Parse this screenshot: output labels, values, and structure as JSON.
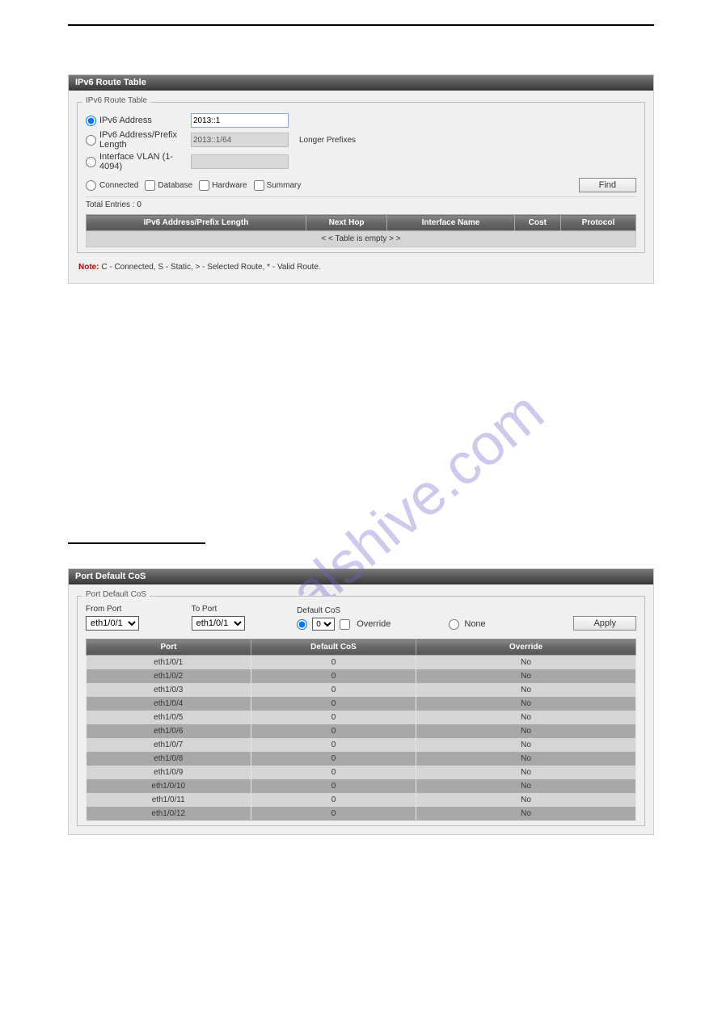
{
  "panel1": {
    "title": "IPv6 Route Table",
    "group_title": "IPv6 Route Table",
    "opt_addr_label": "IPv6 Address",
    "opt_prefix_label": "IPv6 Address/Prefix Length",
    "opt_vlan_label": "Interface VLAN (1-4094)",
    "addr_value": "2013::1",
    "prefix_value": "2013::1/64",
    "longer_prefixes": "Longer Prefixes",
    "f_connected": "Connected",
    "f_database": "Database",
    "f_hardware": "Hardware",
    "f_summary": "Summary",
    "btn_find": "Find",
    "total": "Total Entries : 0",
    "col_addr": "IPv6 Address/Prefix Length",
    "col_next": "Next Hop",
    "col_iface": "Interface Name",
    "col_cost": "Cost",
    "col_proto": "Protocol",
    "empty_msg": "< < Table is empty > >",
    "note_prefix": "Note:",
    "note_text": " C - Connected, S - Static, > - Selected Route, * - Valid Route."
  },
  "panel2": {
    "title": "Port Default CoS",
    "group_title": "Port Default CoS",
    "from_port": "From Port",
    "to_port": "To Port",
    "port_val": "eth1/0/1",
    "default_cos": "Default CoS",
    "cos_val": "0",
    "override": "Override",
    "none": "None",
    "btn_apply": "Apply",
    "col_port": "Port",
    "col_def": "Default CoS",
    "col_over": "Override",
    "rows": [
      {
        "port": "eth1/0/1",
        "d": "0",
        "o": "No"
      },
      {
        "port": "eth1/0/2",
        "d": "0",
        "o": "No"
      },
      {
        "port": "eth1/0/3",
        "d": "0",
        "o": "No"
      },
      {
        "port": "eth1/0/4",
        "d": "0",
        "o": "No"
      },
      {
        "port": "eth1/0/5",
        "d": "0",
        "o": "No"
      },
      {
        "port": "eth1/0/6",
        "d": "0",
        "o": "No"
      },
      {
        "port": "eth1/0/7",
        "d": "0",
        "o": "No"
      },
      {
        "port": "eth1/0/8",
        "d": "0",
        "o": "No"
      },
      {
        "port": "eth1/0/9",
        "d": "0",
        "o": "No"
      },
      {
        "port": "eth1/0/10",
        "d": "0",
        "o": "No"
      },
      {
        "port": "eth1/0/11",
        "d": "0",
        "o": "No"
      },
      {
        "port": "eth1/0/12",
        "d": "0",
        "o": "No"
      }
    ]
  },
  "watermark": "manualshive.com"
}
